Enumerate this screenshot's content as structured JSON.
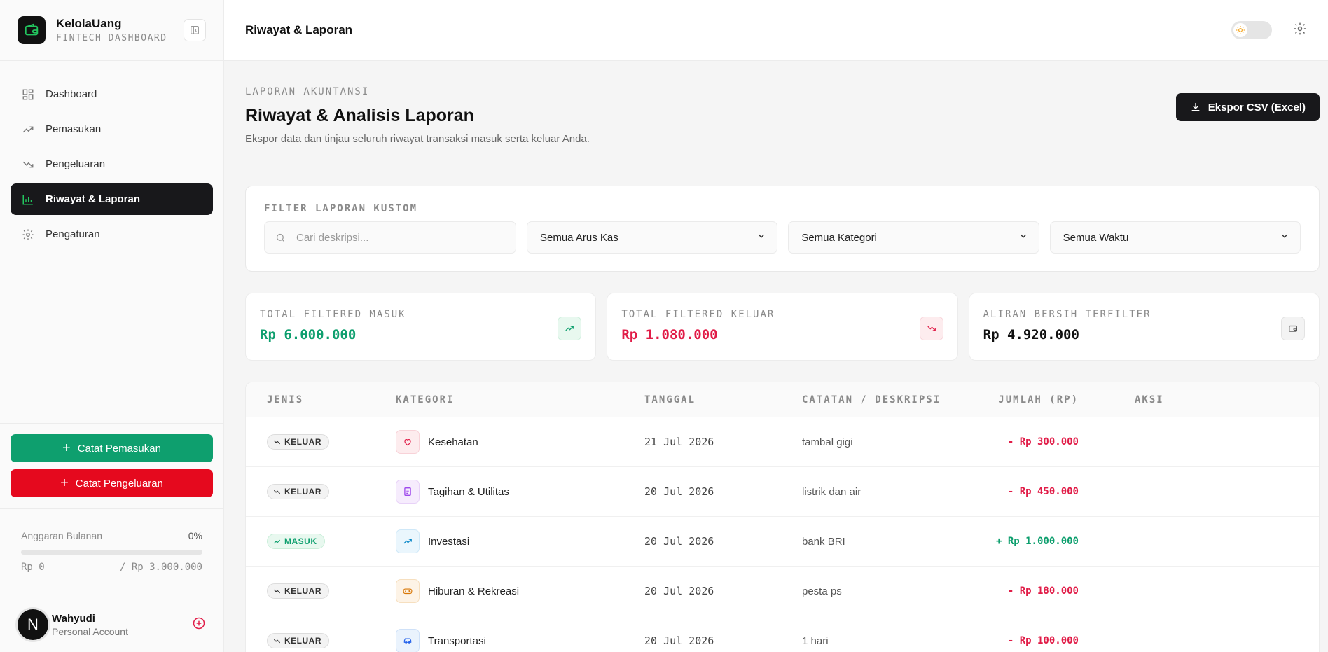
{
  "brand": {
    "name": "KelolaUang",
    "subtitle": "FINTECH DASHBOARD"
  },
  "nav": [
    {
      "label": "Dashboard",
      "icon": "grid-icon",
      "active": false
    },
    {
      "label": "Pemasukan",
      "icon": "trend-up-icon",
      "active": false
    },
    {
      "label": "Pengeluaran",
      "icon": "trend-down-icon",
      "active": false
    },
    {
      "label": "Riwayat & Laporan",
      "icon": "bar-chart-icon",
      "active": true
    },
    {
      "label": "Pengaturan",
      "icon": "gear-icon",
      "active": false
    }
  ],
  "actions": {
    "income": "Catat Pemasukan",
    "expense": "Catat Pengeluaran"
  },
  "budget": {
    "label": "Anggaran Bulanan",
    "percent": "0%",
    "percent_value": 0,
    "spent": "Rp 0",
    "limit": "/ Rp 3.000.000"
  },
  "user": {
    "initial": "N",
    "name": "Wahyudi",
    "role": "Personal Account"
  },
  "topbar": {
    "title": "Riwayat & Laporan"
  },
  "page": {
    "eyebrow": "LAPORAN AKUNTANSI",
    "title": "Riwayat & Analisis Laporan",
    "subtitle": "Ekspor data dan tinjau seluruh riwayat transaksi masuk serta keluar Anda.",
    "export_label": "Ekspor CSV (Excel)"
  },
  "filter": {
    "title": "FILTER LAPORAN KUSTOM",
    "search_placeholder": "Cari deskripsi...",
    "flow": "Semua Arus Kas",
    "category": "Semua Kategori",
    "time": "Semua Waktu"
  },
  "stats": {
    "income": {
      "label": "TOTAL FILTERED MASUK",
      "value": "Rp 6.000.000"
    },
    "expense": {
      "label": "TOTAL FILTERED KELUAR",
      "value": "Rp 1.080.000"
    },
    "net": {
      "label": "ALIRAN BERSIH TERFILTER",
      "value": "Rp 4.920.000"
    }
  },
  "table": {
    "headers": [
      "JENIS",
      "KATEGORI",
      "TANGGAL",
      "CATATAN / DESKRIPSI",
      "JUMLAH (RP)",
      "AKSI"
    ],
    "rows": [
      {
        "type": "KELUAR",
        "category": "Kesehatan",
        "date": "21 Jul 2026",
        "note": "tambal gigi",
        "amount": "- Rp 300.000"
      },
      {
        "type": "KELUAR",
        "category": "Tagihan & Utilitas",
        "date": "20 Jul 2026",
        "note": "listrik dan air",
        "amount": "- Rp 450.000"
      },
      {
        "type": "MASUK",
        "category": "Investasi",
        "date": "20 Jul 2026",
        "note": "bank BRI",
        "amount": "+ Rp 1.000.000"
      },
      {
        "type": "KELUAR",
        "category": "Hiburan & Rekreasi",
        "date": "20 Jul 2026",
        "note": "pesta ps",
        "amount": "- Rp 180.000"
      },
      {
        "type": "KELUAR",
        "category": "Transportasi",
        "date": "20 Jul 2026",
        "note": "1 hari",
        "amount": "- Rp 100.000"
      }
    ]
  },
  "colors": {
    "accent": "#18181b",
    "income": "#0e9f6e",
    "expense": "#e5091e"
  }
}
